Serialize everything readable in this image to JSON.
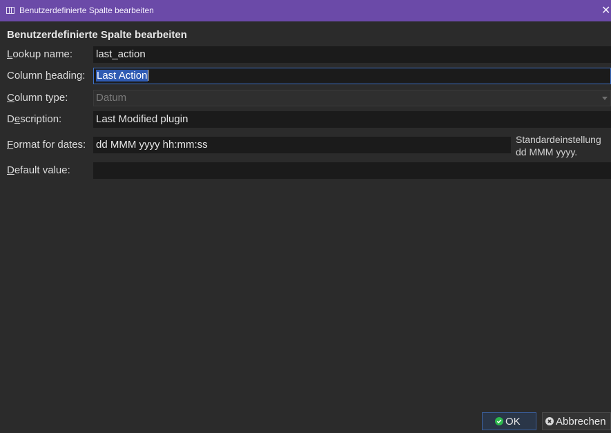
{
  "window": {
    "title": "Benutzerdefinierte Spalte bearbeiten"
  },
  "heading": "Benutzerdefinierte Spalte bearbeiten",
  "fields": {
    "lookup_name": {
      "label_pre": "",
      "label_key": "L",
      "label_post": "ookup name:",
      "value": "last_action"
    },
    "column_heading": {
      "label_pre": "Column ",
      "label_key": "h",
      "label_post": "eading:",
      "value": "Last Action"
    },
    "column_type": {
      "label_pre": "",
      "label_key": "C",
      "label_post": "olumn type:",
      "value": "Datum"
    },
    "description": {
      "label_pre": "D",
      "label_key": "e",
      "label_post": "scription:",
      "value": "Last Modified plugin"
    },
    "format_for_dates": {
      "label_pre": "",
      "label_key": "F",
      "label_post": "ormat for dates:",
      "value": "dd MMM yyyy hh:mm:ss"
    },
    "default_value": {
      "label_pre": "",
      "label_key": "D",
      "label_post": "efault value:",
      "value": ""
    }
  },
  "format_hint": {
    "line1": "Standardeinstellung",
    "line2": "dd MMM yyyy."
  },
  "buttons": {
    "ok": "OK",
    "cancel": "Abbrechen"
  },
  "colors": {
    "titlebar": "#6b4aa8",
    "background": "#2b2b2b",
    "field_bg": "#1b1b1b",
    "focus_border": "#3d6fc4",
    "selection": "#2f5bb3",
    "ok_icon": "#2db84d"
  },
  "icons": {
    "app": "columns-icon",
    "close": "close-icon",
    "ok": "check-circle-icon",
    "cancel": "x-circle-icon",
    "dropdown": "chevron-down-icon"
  }
}
